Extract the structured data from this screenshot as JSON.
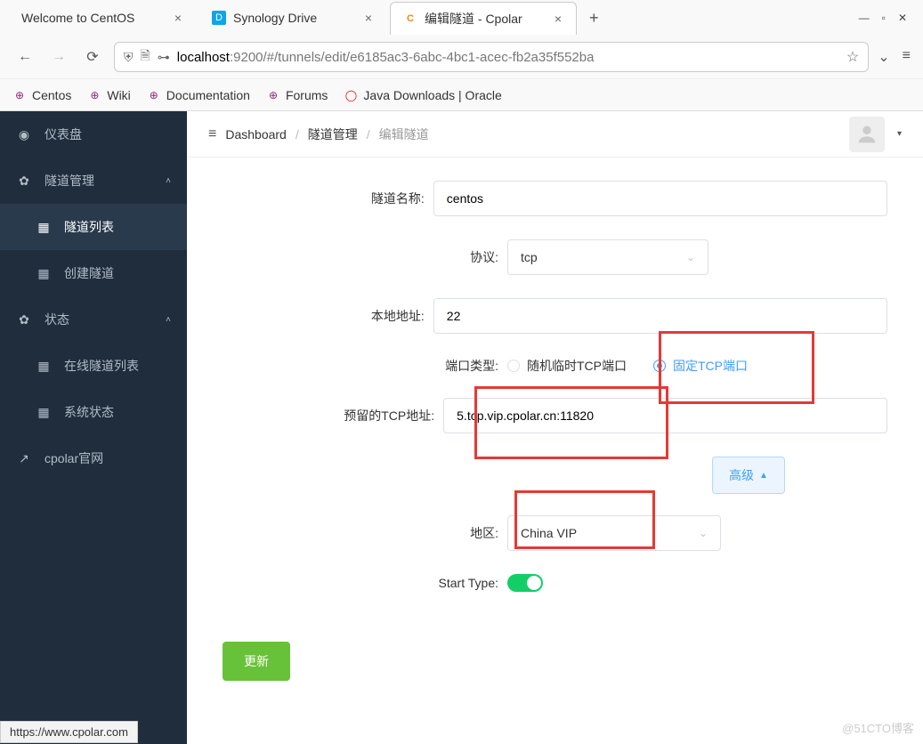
{
  "browser": {
    "tabs": [
      {
        "label": "Welcome to CentOS",
        "active": false,
        "icon": ""
      },
      {
        "label": "Synology Drive",
        "active": false,
        "icon": "D"
      },
      {
        "label": "编辑隧道 - Cpolar",
        "active": true,
        "icon": "C"
      }
    ],
    "url_host": "localhost",
    "url_rest": ":9200/#/tunnels/edit/e6185ac3-6abc-4bc1-acec-fb2a35f552ba",
    "bookmarks": [
      {
        "label": "Centos"
      },
      {
        "label": "Wiki"
      },
      {
        "label": "Documentation"
      },
      {
        "label": "Forums"
      },
      {
        "label": "Java Downloads | Oracle"
      }
    ]
  },
  "sidebar": {
    "items": [
      {
        "label": "仪表盘",
        "nested": false
      },
      {
        "label": "隧道管理",
        "nested": false,
        "expandable": true
      },
      {
        "label": "隧道列表",
        "nested": true,
        "active": true
      },
      {
        "label": "创建隧道",
        "nested": true
      },
      {
        "label": "状态",
        "nested": false,
        "expandable": true
      },
      {
        "label": "在线隧道列表",
        "nested": true
      },
      {
        "label": "系统状态",
        "nested": true
      },
      {
        "label": "cpolar官网",
        "nested": false,
        "external": true
      }
    ]
  },
  "breadcrumb": {
    "root": "Dashboard",
    "mid": "隧道管理",
    "current": "编辑隧道"
  },
  "form": {
    "tunnel_name_label": "隧道名称:",
    "tunnel_name_value": "centos",
    "protocol_label": "协议:",
    "protocol_value": "tcp",
    "local_addr_label": "本地地址:",
    "local_addr_value": "22",
    "port_type_label": "端口类型:",
    "port_type_random": "随机临时TCP端口",
    "port_type_fixed": "固定TCP端口",
    "reserved_tcp_label": "预留的TCP地址:",
    "reserved_tcp_value": "5.tcp.vip.cpolar.cn:11820",
    "advanced_label": "高级",
    "region_label": "地区:",
    "region_value": "China VIP",
    "start_type_label": "Start Type:",
    "submit_label": "更新"
  },
  "status_bar": "https://www.cpolar.com",
  "watermark": "@51CTO博客"
}
